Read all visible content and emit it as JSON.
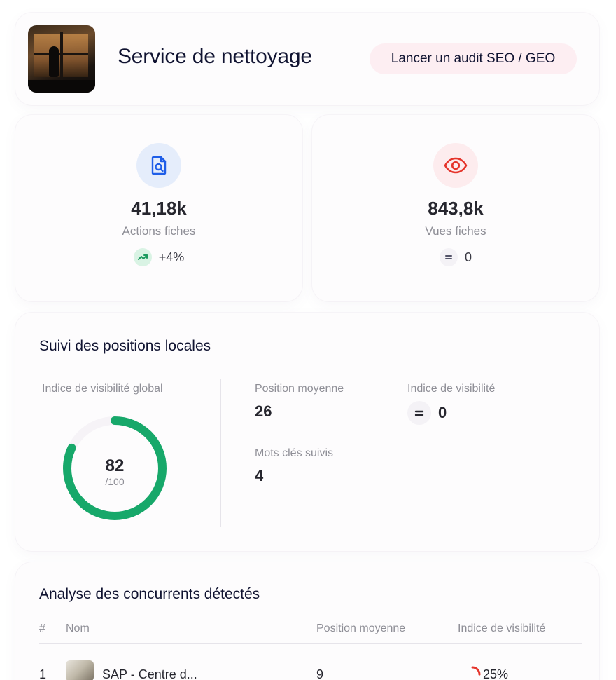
{
  "header": {
    "title": "Service de nettoyage",
    "audit_button": "Lancer un audit SEO / GEO"
  },
  "stats": [
    {
      "icon": "file-search-icon",
      "value": "41,18k",
      "label": "Actions fiches",
      "trend_icon": "trend-up-icon",
      "trend": "+4%",
      "icon_color": "#1f5ee8",
      "icon_bg": "#e5edfb",
      "trend_color": "#1a9a5e",
      "trend_bg": "#d9f3e4"
    },
    {
      "icon": "eye-icon",
      "value": "843,8k",
      "label": "Vues fiches",
      "trend_icon": "equal-icon",
      "trend": "0",
      "icon_color": "#e5342b",
      "icon_bg": "#fdecee",
      "trend_color": "#55556a",
      "trend_bg": "#f4f2f6"
    }
  ],
  "positions": {
    "title": "Suivi des positions locales",
    "global_visibility_label": "Indice de visibilité global",
    "global_visibility_value": "82",
    "global_visibility_max": "/100",
    "global_visibility_ratio": 0.82,
    "ring_color": "#17a86a",
    "avg_position_label": "Position moyenne",
    "avg_position_value": "26",
    "visibility_index_label": "Indice de visibilité",
    "visibility_index_value": "0",
    "keywords_label": "Mots clés suivis",
    "keywords_value": "4"
  },
  "competitors": {
    "title": "Analyse des concurrents détectés",
    "columns": [
      "#",
      "Nom",
      "Position moyenne",
      "Indice de visibilité"
    ],
    "rows": [
      {
        "rank": "1",
        "name": "SAP - Centre d...",
        "avg_position": "9",
        "visibility": "25%",
        "visibility_ratio": 0.25
      }
    ]
  }
}
